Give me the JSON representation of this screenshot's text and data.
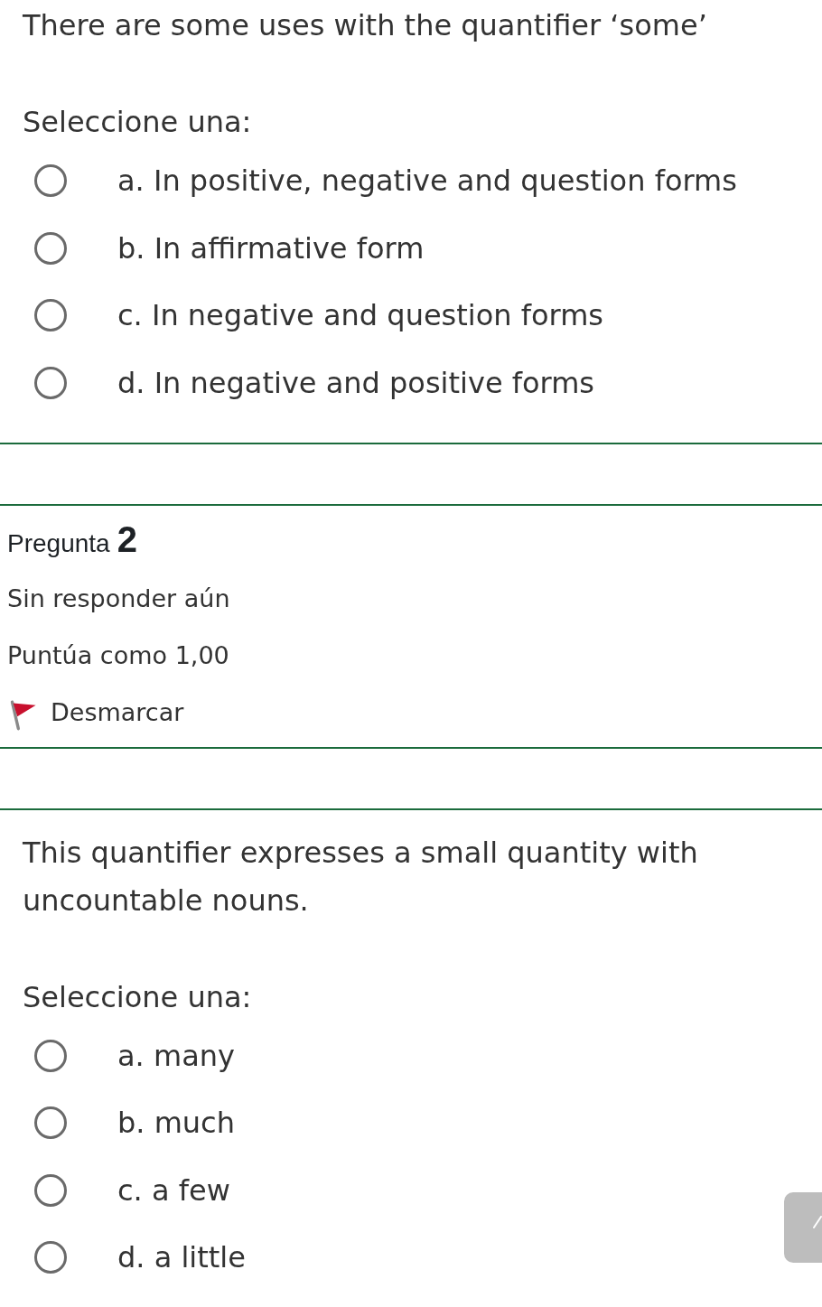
{
  "questions": [
    {
      "text": "There are some uses with the quantifier ‘some’",
      "prompt": "Seleccione una:",
      "options": [
        {
          "label": "a. In positive, negative and question forms",
          "selected": false
        },
        {
          "label": "b. In affirmative form",
          "selected": false
        },
        {
          "label": "c. In negative and question forms",
          "selected": false
        },
        {
          "label": "d. In negative and positive forms",
          "selected": false
        }
      ]
    },
    {
      "info": {
        "label": "Pregunta",
        "number": "2",
        "status": "Sin responder aún",
        "grade": "Puntúa como 1,00",
        "flag": {
          "label": "Desmarcar",
          "flagged": true
        }
      },
      "text": "This quantifier expresses a small quantity with uncountable nouns.",
      "prompt": "Seleccione una:",
      "options": [
        {
          "label": "a. many",
          "selected": false
        },
        {
          "label": "b. much",
          "selected": false
        },
        {
          "label": "c. a few",
          "selected": false
        },
        {
          "label": "d. a little",
          "selected": false
        }
      ]
    }
  ]
}
